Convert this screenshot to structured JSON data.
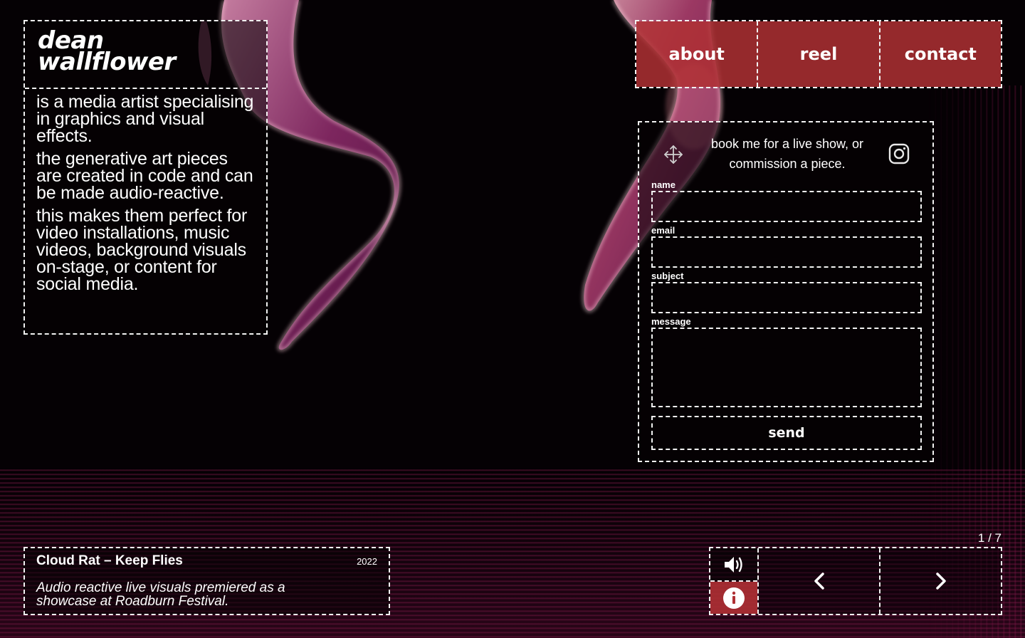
{
  "colors": {
    "accent": "#af3034",
    "background": "#050104",
    "foreground": "#ffffff"
  },
  "intro": {
    "name_line1": "dean",
    "name_line2": "wallflower",
    "paragraphs": [
      "is a media artist specialising in graphics and visual effects.",
      "the generative art pieces are created in code and can be made audio-reactive.",
      "this makes them perfect for video installations, music videos, background visuals on-stage, or content for social media."
    ]
  },
  "nav": {
    "about": "about",
    "reel": "reel",
    "contact": "contact"
  },
  "contact_form": {
    "tagline": "book me for a live show, or commission a piece.",
    "move_icon": "move-icon",
    "social_icon": "instagram-icon",
    "fields": {
      "name": {
        "label": "name",
        "value": ""
      },
      "email": {
        "label": "email",
        "value": ""
      },
      "subject": {
        "label": "subject",
        "value": ""
      },
      "message": {
        "label": "message",
        "value": ""
      }
    },
    "send_label": "send"
  },
  "caption": {
    "title": "Cloud Rat – Keep Flies",
    "year": "2022",
    "description": "Audio reactive live visuals premiered as a showcase at Roadburn Festival."
  },
  "slideshow": {
    "counter": "1 / 7",
    "sound_icon": "volume-icon",
    "info_icon": "info-icon",
    "prev_icon": "chevron-left-icon",
    "next_icon": "chevron-right-icon"
  }
}
